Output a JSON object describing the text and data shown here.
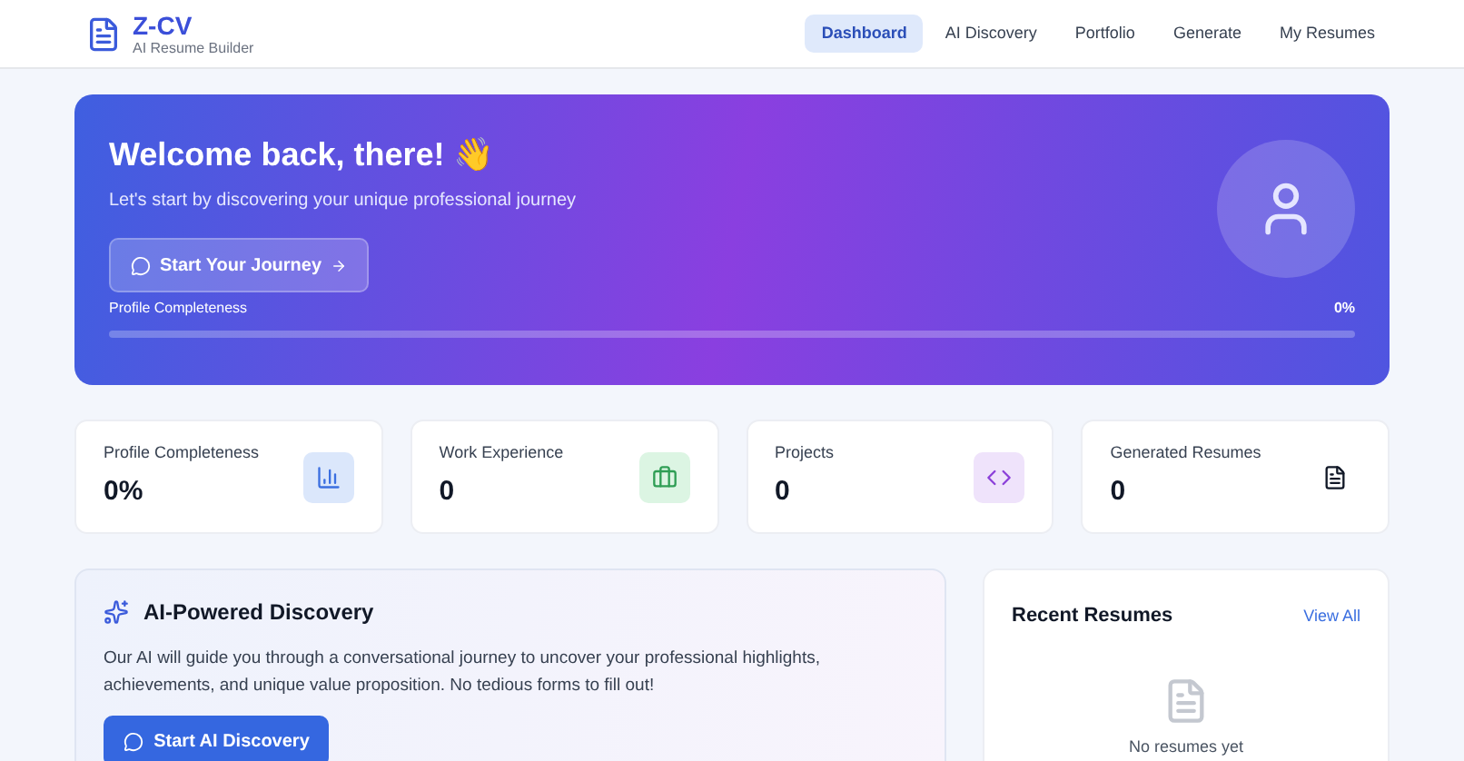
{
  "header": {
    "brand": "Z-CV",
    "tagline": "AI Resume Builder",
    "nav": [
      {
        "label": "Dashboard",
        "selected": true
      },
      {
        "label": "AI Discovery",
        "selected": false
      },
      {
        "label": "Portfolio",
        "selected": false
      },
      {
        "label": "Generate",
        "selected": false
      },
      {
        "label": "My Resumes",
        "selected": false
      }
    ]
  },
  "hero": {
    "title": "Welcome back, there! 👋",
    "subtitle": "Let's start by discovering your unique professional journey",
    "button": "Start Your Journey",
    "progress_label": "Profile Completeness",
    "progress_value": "0%",
    "level": 0
  },
  "stats": [
    {
      "kind": "chart",
      "label": "Profile Completeness",
      "value": "0%"
    },
    {
      "kind": "briefcase",
      "label": "Work Experience",
      "value": "0"
    },
    {
      "kind": "code",
      "label": "Projects",
      "value": "0"
    },
    {
      "kind": "file",
      "label": "Generated Resumes",
      "value": "0"
    }
  ],
  "discovery": {
    "title": "AI-Powered Discovery",
    "text": "Our AI will guide you through a conversational journey to uncover your professional highlights, achievements, and unique value proposition. No tedious forms to fill out!",
    "button": "Start AI Discovery"
  },
  "recent": {
    "title": "Recent Resumes",
    "link": "View All",
    "empty": "No resumes yet"
  }
}
